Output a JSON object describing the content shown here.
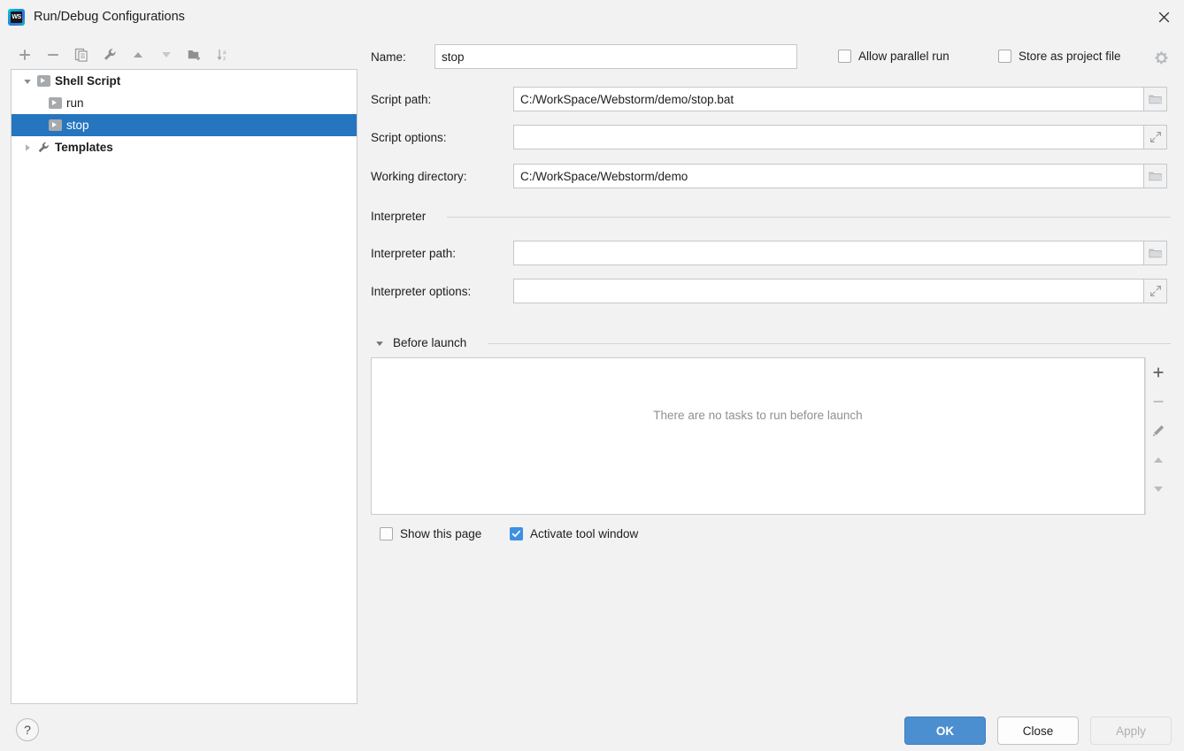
{
  "window": {
    "title": "Run/Debug Configurations",
    "app_icon": "webstorm-logo",
    "app_icon_text": "WS",
    "close_icon": "close-icon"
  },
  "toolbar": {
    "items": [
      {
        "name": "add-configuration-button",
        "icon": "plus-icon",
        "tooltip": "Add New Configuration"
      },
      {
        "name": "remove-configuration-button",
        "icon": "minus-icon",
        "tooltip": "Remove Configuration"
      },
      {
        "name": "copy-configuration-button",
        "icon": "copy-icon",
        "tooltip": "Copy Configuration"
      },
      {
        "name": "edit-templates-button",
        "icon": "wrench-icon",
        "tooltip": "Edit Templates"
      },
      {
        "name": "move-up-button",
        "icon": "arrow-up-icon",
        "tooltip": "Move Up"
      },
      {
        "name": "move-down-button",
        "icon": "arrow-down-icon",
        "tooltip": "Move Down"
      },
      {
        "name": "create-folder-button",
        "icon": "folder-add-icon",
        "tooltip": "Create New Folder"
      },
      {
        "name": "sort-configurations-button",
        "icon": "sort-alpha-icon",
        "tooltip": "Sort Configurations"
      }
    ]
  },
  "tree": {
    "nodes": [
      {
        "label": "Shell Script",
        "icon": "script-icon",
        "expanded": true,
        "bold": true,
        "selected": false,
        "indent": 0,
        "twisty": "down"
      },
      {
        "label": "run",
        "icon": "script-icon",
        "bold": false,
        "selected": false,
        "indent": 1,
        "twisty": "none"
      },
      {
        "label": "stop",
        "icon": "script-icon",
        "bold": false,
        "selected": true,
        "indent": 1,
        "twisty": "none"
      },
      {
        "label": "Templates",
        "icon": "wrench-icon",
        "expanded": false,
        "bold": true,
        "selected": false,
        "indent": 0,
        "twisty": "right"
      }
    ]
  },
  "form": {
    "name_label": "Name:",
    "name_value": "stop",
    "allow_parallel_run": {
      "label": "Allow parallel run",
      "checked": false
    },
    "store_as_project_file": {
      "label": "Store as project file",
      "checked": false
    },
    "settings_gear_icon": "gear-icon",
    "script_path_label": "Script path:",
    "script_path_value": "C:/WorkSpace/Webstorm/demo/stop.bat",
    "script_path_browse_icon": "folder-icon",
    "script_options_label": "Script options:",
    "script_options_value": "",
    "script_options_expand_icon": "expand-icon",
    "working_directory_label": "Working directory:",
    "working_directory_value": "C:/WorkSpace/Webstorm/demo",
    "working_directory_browse_icon": "folder-icon",
    "interpreter_group_label": "Interpreter",
    "interpreter_path_label": "Interpreter path:",
    "interpreter_path_value": "",
    "interpreter_path_browse_icon": "folder-icon",
    "interpreter_options_label": "Interpreter options:",
    "interpreter_options_value": "",
    "interpreter_options_expand_icon": "expand-icon"
  },
  "before_launch": {
    "title": "Before launch",
    "expanded": true,
    "empty_text": "There are no tasks to run before launch",
    "toolbar": [
      {
        "name": "add-task-button",
        "icon": "plus-icon"
      },
      {
        "name": "remove-task-button",
        "icon": "minus-icon"
      },
      {
        "name": "edit-task-button",
        "icon": "pencil-icon"
      },
      {
        "name": "move-task-up-button",
        "icon": "arrow-up-icon"
      },
      {
        "name": "move-task-down-button",
        "icon": "arrow-down-icon"
      }
    ],
    "show_this_page": {
      "label": "Show this page",
      "checked": false
    },
    "activate_tool_window": {
      "label": "Activate tool window",
      "checked": true
    }
  },
  "footer": {
    "help_label": "?",
    "ok_label": "OK",
    "close_label": "Close",
    "apply_label": "Apply",
    "apply_disabled": true
  },
  "colors": {
    "accent": "#2675bf",
    "primary_button": "#4c8fd1",
    "checkbox_checked": "#3d90e3",
    "panel_bg": "#f2f2f2",
    "field_bg": "#ffffff"
  }
}
